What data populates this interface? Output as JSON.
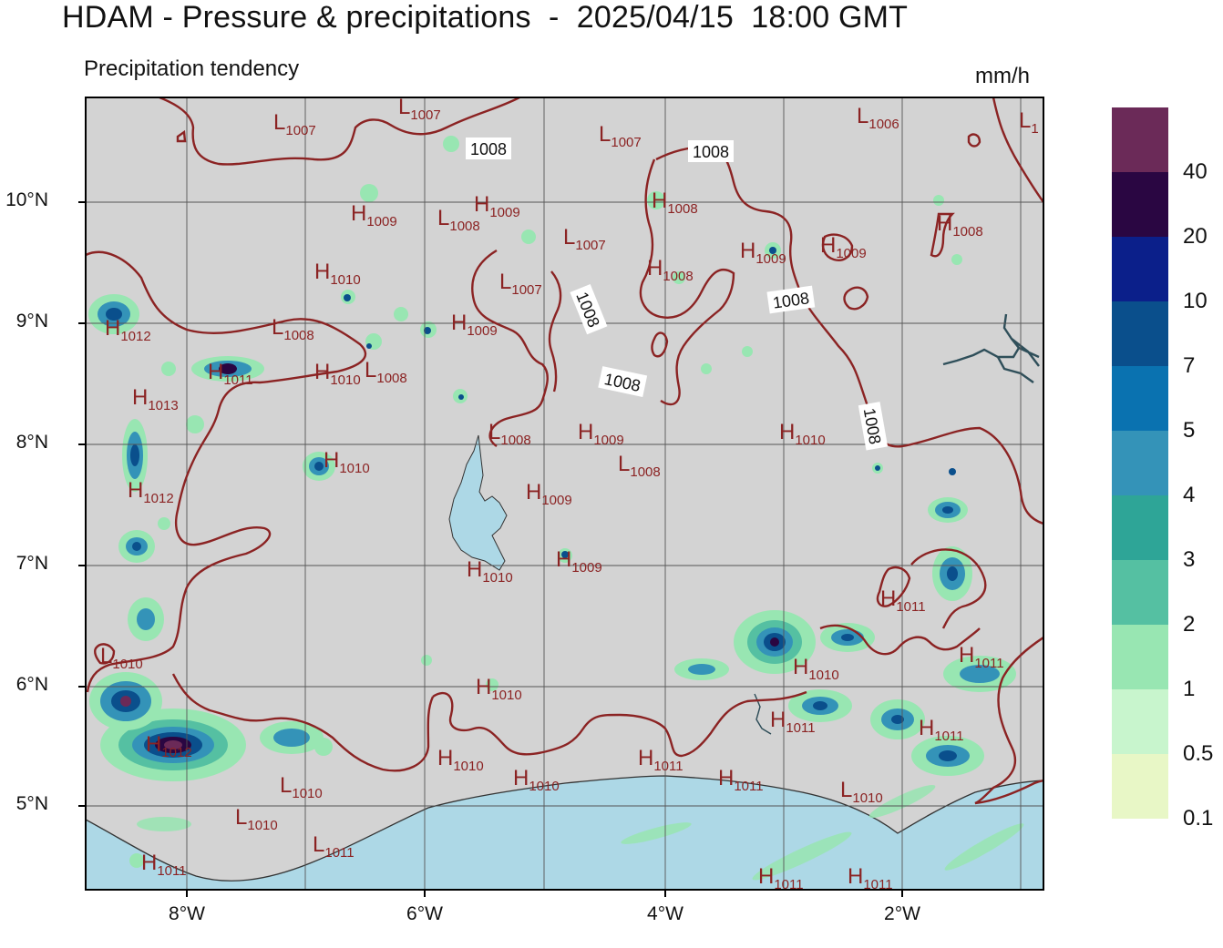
{
  "header": {
    "title": "HDAM - Pressure & precipitations  -  2025/04/15  18:00 GMT",
    "subtitle": "Precipitation tendency",
    "units": "mm/h"
  },
  "axes": {
    "lat_labels": [
      "10°N",
      "9°N",
      "8°N",
      "7°N",
      "6°N",
      "5°N"
    ],
    "lon_labels": [
      "8°W",
      "6°W",
      "4°W",
      "2°W"
    ]
  },
  "colorbar": {
    "labels": [
      "40",
      "20",
      "10",
      "7",
      "5",
      "4",
      "3",
      "2",
      "1",
      "0.5",
      "0.1"
    ],
    "colors": [
      "#6b2a58",
      "#2a0642",
      "#0b1f8a",
      "#0a4f8c",
      "#0a72b0",
      "#3493b8",
      "#2ea597",
      "#55c0a2",
      "#98e6b2",
      "#c8f5cd",
      "#e8f7c6"
    ]
  },
  "pressure_labels": [
    {
      "type": "L",
      "value": "1007"
    },
    {
      "type": "L",
      "value": "1007"
    },
    {
      "type": "L",
      "value": "1007"
    },
    {
      "type": "L",
      "value": "1006"
    },
    {
      "type": "L",
      "value": "1"
    },
    {
      "type": "H",
      "value": "1009"
    },
    {
      "type": "H",
      "value": "1009"
    },
    {
      "type": "L",
      "value": "1008"
    },
    {
      "type": "L",
      "value": "1007"
    },
    {
      "type": "H",
      "value": "1008"
    },
    {
      "type": "H",
      "value": "1009"
    },
    {
      "type": "H",
      "value": "1009"
    },
    {
      "type": "H",
      "value": "1008"
    },
    {
      "type": "H",
      "value": "1010"
    },
    {
      "type": "L",
      "value": "1007"
    },
    {
      "type": "H",
      "value": "1008"
    },
    {
      "type": "H",
      "value": "1012"
    },
    {
      "type": "L",
      "value": "1008"
    },
    {
      "type": "H",
      "value": "1009"
    },
    {
      "type": "H",
      "value": "1011"
    },
    {
      "type": "H",
      "value": "1010"
    },
    {
      "type": "L",
      "value": "1008"
    },
    {
      "type": "H",
      "value": "1013"
    },
    {
      "type": "L",
      "value": "1008"
    },
    {
      "type": "H",
      "value": "1009"
    },
    {
      "type": "H",
      "value": "1010"
    },
    {
      "type": "H",
      "value": "1010"
    },
    {
      "type": "L",
      "value": "1008"
    },
    {
      "type": "H",
      "value": "1012"
    },
    {
      "type": "H",
      "value": "1009"
    },
    {
      "type": "H",
      "value": "1010"
    },
    {
      "type": "H",
      "value": "1009"
    },
    {
      "type": "H",
      "value": "1011"
    },
    {
      "type": "H",
      "value": "1011"
    },
    {
      "type": "L",
      "value": "1010"
    },
    {
      "type": "H",
      "value": "1010"
    },
    {
      "type": "H",
      "value": "1011"
    },
    {
      "type": "H",
      "value": "1011"
    },
    {
      "type": "H",
      "value": "1012"
    },
    {
      "type": "H",
      "value": "1010"
    },
    {
      "type": "H",
      "value": "1010"
    },
    {
      "type": "H",
      "value": "1010"
    },
    {
      "type": "H",
      "value": "1011"
    },
    {
      "type": "H",
      "value": "1011"
    },
    {
      "type": "L",
      "value": "1010"
    },
    {
      "type": "L",
      "value": "1010"
    },
    {
      "type": "L",
      "value": "1010"
    },
    {
      "type": "L",
      "value": "1011"
    },
    {
      "type": "H",
      "value": "1011"
    },
    {
      "type": "H",
      "value": "1011"
    },
    {
      "type": "H",
      "value": "1011"
    }
  ],
  "isobar_labels": [
    "1008",
    "1008",
    "1008",
    "1008",
    "1008",
    "1008"
  ]
}
